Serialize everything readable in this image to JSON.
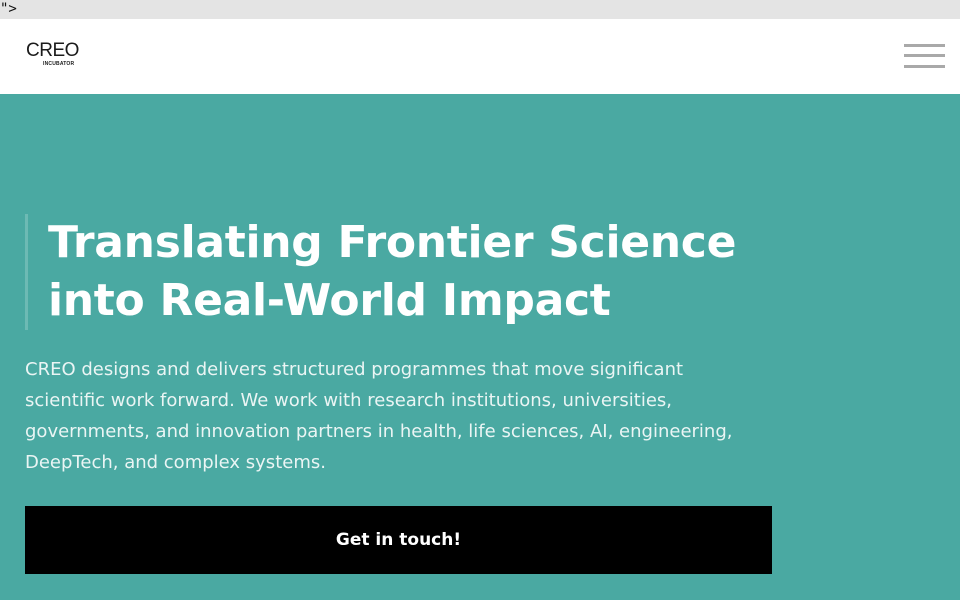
{
  "stray_text": "\">",
  "header": {
    "logo_word": "CREO",
    "logo_sub": "INCUBATOR",
    "menu_icon": "hamburger-menu-icon"
  },
  "hero": {
    "title_line1": "Translating Frontier Science",
    "title_line2": "into Real-World Impact",
    "description": "CREO designs and delivers structured programmes that move significant scientific work forward. We work with research institutions, universities, governments, and innovation partners in health, life sciences, AI, engineering, DeepTech, and complex systems.",
    "cta_label": "Get in touch!"
  },
  "colors": {
    "hero_background": "#4aa9a2",
    "header_background": "#ffffff",
    "cta_background": "#000000",
    "menu_icon": "#a9a9a9"
  }
}
